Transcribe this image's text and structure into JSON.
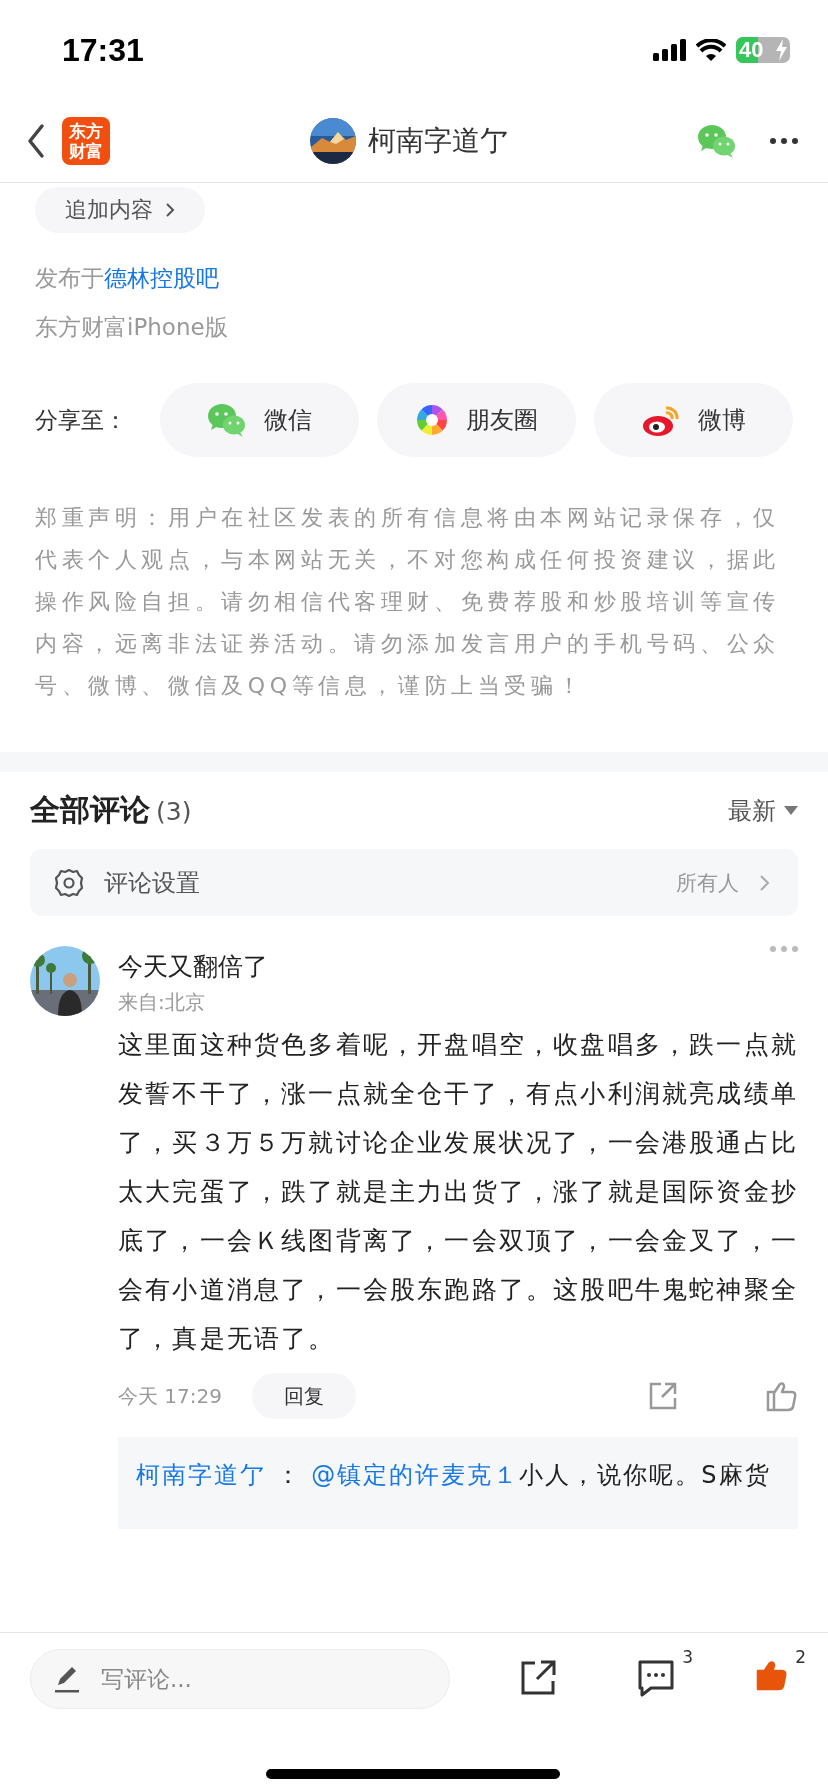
{
  "status_bar": {
    "time": "17:31",
    "battery": "40",
    "charging": true
  },
  "nav": {
    "logo_lines": [
      "东方",
      "财富"
    ],
    "title": "柯南字道亇"
  },
  "post": {
    "append_button": "追加内容",
    "published_prefix": "发布于",
    "forum": "德林控股吧",
    "source": "东方财富iPhone版"
  },
  "share": {
    "label": "分享至：",
    "targets": [
      {
        "kind": "wechat",
        "label": "微信"
      },
      {
        "kind": "moments",
        "label": "朋友圈"
      },
      {
        "kind": "weibo",
        "label": "微博"
      }
    ]
  },
  "disclaimer": "郑重声明：用户在社区发表的所有信息将由本网站记录保存，仅代表个人观点，与本网站无关，不对您构成任何投资建议，据此操作风险自担。请勿相信代客理财、免费荐股和炒股培训等宣传内容，远离非法证券活动。请勿添加发言用户的手机号码、公众号、微博、微信及QQ等信息，谨防上当受骗！",
  "comments": {
    "title": "全部评论",
    "count": "(3)",
    "sort": "最新",
    "settings": {
      "label": "评论设置",
      "value": "所有人"
    },
    "items": [
      {
        "username": "今天又翻倍了",
        "location": "来自:北京",
        "body": "这里面这种货色多着呢，开盘唱空，收盘唱多，跌一点就发誓不干了，涨一点就全仓干了，有点小利润就亮成绩单了，买３万５万就讨论企业发展状况了，一会港股通占比太大完蛋了，跌了就是主力出货了，涨了就是国际资金抄底了，一会Ｋ线图背离了，一会双顶了，一会金叉了，一会有小道消息了，一会股东跑路了。这股吧牛鬼蛇神聚全了，真是无语了。",
        "time": "今天 17:29",
        "reply_button": "回复",
        "liked": false,
        "replies": [
          {
            "author": "柯南字道亇",
            "separator": "：",
            "mention": "@镇定的许麦克１",
            "text": "小人，说你呢。S麻货"
          }
        ]
      }
    ]
  },
  "bottom_bar": {
    "placeholder": "写评论...",
    "comment_count": "3",
    "like_count": "2",
    "liked": true
  }
}
